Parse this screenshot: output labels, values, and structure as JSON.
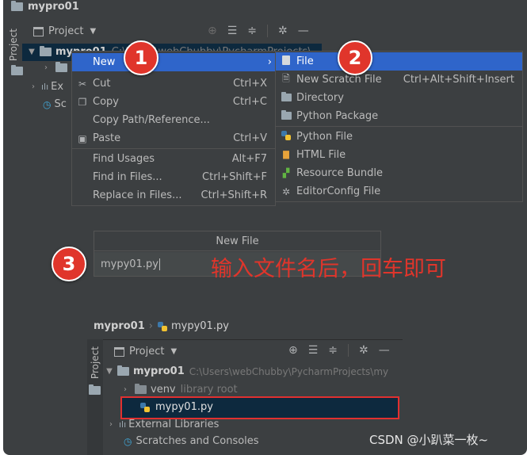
{
  "colors": {
    "background": "#3c3f41",
    "selection": "#2f65ca",
    "badge": "#e0352b",
    "annotation": "#e0352b",
    "dim_text": "#787878",
    "highlight_box": "#e03030"
  },
  "top": {
    "title": "mypro01",
    "side_tab": "Project",
    "project_dropdown": "Project",
    "root_name": "mypro01",
    "root_path": "C:\\Users\\webChubby\\PycharmProjects\\",
    "item_ext": "Ex",
    "item_sc": "Sc"
  },
  "context_menu": {
    "items": [
      {
        "label": "New",
        "shortcut": "",
        "icon": ""
      },
      {
        "label": "Cut",
        "shortcut": "Ctrl+X",
        "icon": "scissors-icon"
      },
      {
        "label": "Copy",
        "shortcut": "Ctrl+C",
        "icon": "copy-icon"
      },
      {
        "label": "Copy Path/Reference...",
        "shortcut": "",
        "icon": ""
      },
      {
        "label": "Paste",
        "shortcut": "Ctrl+V",
        "icon": "paste-icon"
      },
      {
        "label": "Find Usages",
        "shortcut": "Alt+F7",
        "icon": ""
      },
      {
        "label": "Find in Files...",
        "shortcut": "Ctrl+Shift+F",
        "icon": ""
      },
      {
        "label": "Replace in Files...",
        "shortcut": "Ctrl+Shift+R",
        "icon": ""
      }
    ]
  },
  "submenu": {
    "items": [
      {
        "label": "File",
        "shortcut": "",
        "icon": "file-icon"
      },
      {
        "label": "New Scratch File",
        "shortcut": "Ctrl+Alt+Shift+Insert",
        "icon": "scratch-file-icon"
      },
      {
        "label": "Directory",
        "shortcut": "",
        "icon": "folder-icon"
      },
      {
        "label": "Python Package",
        "shortcut": "",
        "icon": "package-icon"
      },
      {
        "label": "Python File",
        "shortcut": "",
        "icon": "python-file-icon"
      },
      {
        "label": "HTML File",
        "shortcut": "",
        "icon": "html-file-icon"
      },
      {
        "label": "Resource Bundle",
        "shortcut": "",
        "icon": "resource-bundle-icon"
      },
      {
        "label": "EditorConfig File",
        "shortcut": "",
        "icon": "gear-icon"
      }
    ]
  },
  "badges": [
    "1",
    "2",
    "3"
  ],
  "new_file_dialog": {
    "title": "New File",
    "value": "mypy01.py"
  },
  "annotation": "输入文件名后，回车即可",
  "bottom": {
    "breadcrumb_root": "mypro01",
    "breadcrumb_file": "mypy01.py",
    "side_tab": "Project",
    "project_dropdown": "Project",
    "root_name": "mypro01",
    "root_path": "C:\\Users\\webChubby\\PycharmProjects\\my",
    "venv_name": "venv",
    "venv_note": "library root",
    "file_name": "mypy01.py",
    "external_libraries": "External Libraries",
    "scratches": "Scratches and Consoles"
  },
  "watermark": "CSDN @小趴菜一枚~"
}
